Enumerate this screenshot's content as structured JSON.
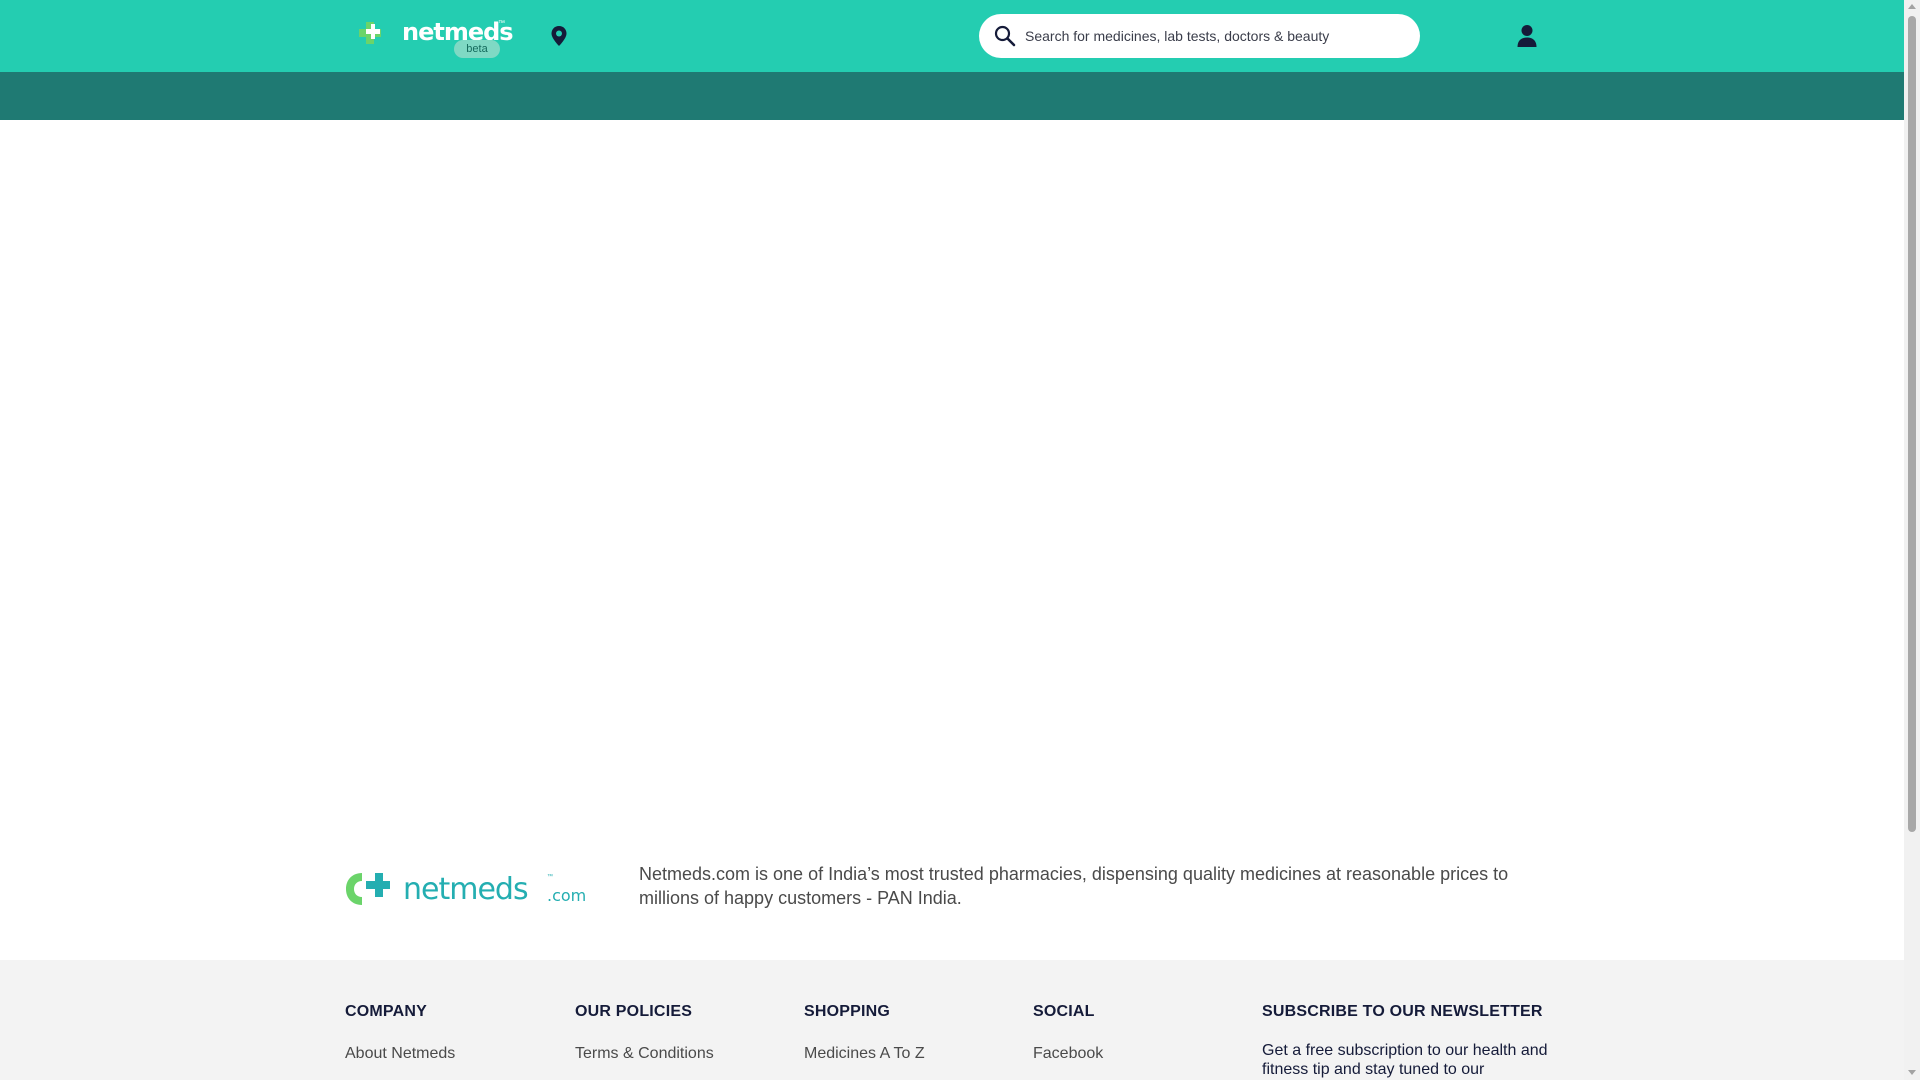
{
  "header": {
    "brand": {
      "name": "netmeds",
      "tm": "™",
      "badge": "beta"
    },
    "search": {
      "placeholder": "Search for medicines, lab tests, doctors & beauty"
    },
    "icons": {
      "location": "location-pin-icon",
      "search": "search-icon",
      "account": "user-account-icon"
    },
    "colors": {
      "header_bg": "#24cdb1",
      "subnav_bg": "#1f7a73"
    }
  },
  "about": {
    "brand": {
      "name": "netmeds",
      "suffix": ".com",
      "tm": "™"
    },
    "text": "Netmeds.com is one of India’s most trusted pharmacies, dispensing quality medicines at reasonable prices to millions of happy customers - PAN India."
  },
  "footer": {
    "columns": [
      {
        "title": "COMPANY",
        "links": [
          "About Netmeds"
        ]
      },
      {
        "title": "OUR POLICIES",
        "links": [
          "Terms & Conditions"
        ]
      },
      {
        "title": "SHOPPING",
        "links": [
          "Medicines A To Z"
        ]
      },
      {
        "title": "SOCIAL",
        "links": [
          "Facebook"
        ]
      }
    ],
    "newsletter": {
      "title": "SUBSCRIBE TO OUR NEWSLETTER",
      "text": "Get a free subscription to our health and fitness tip and stay tuned to our"
    }
  }
}
